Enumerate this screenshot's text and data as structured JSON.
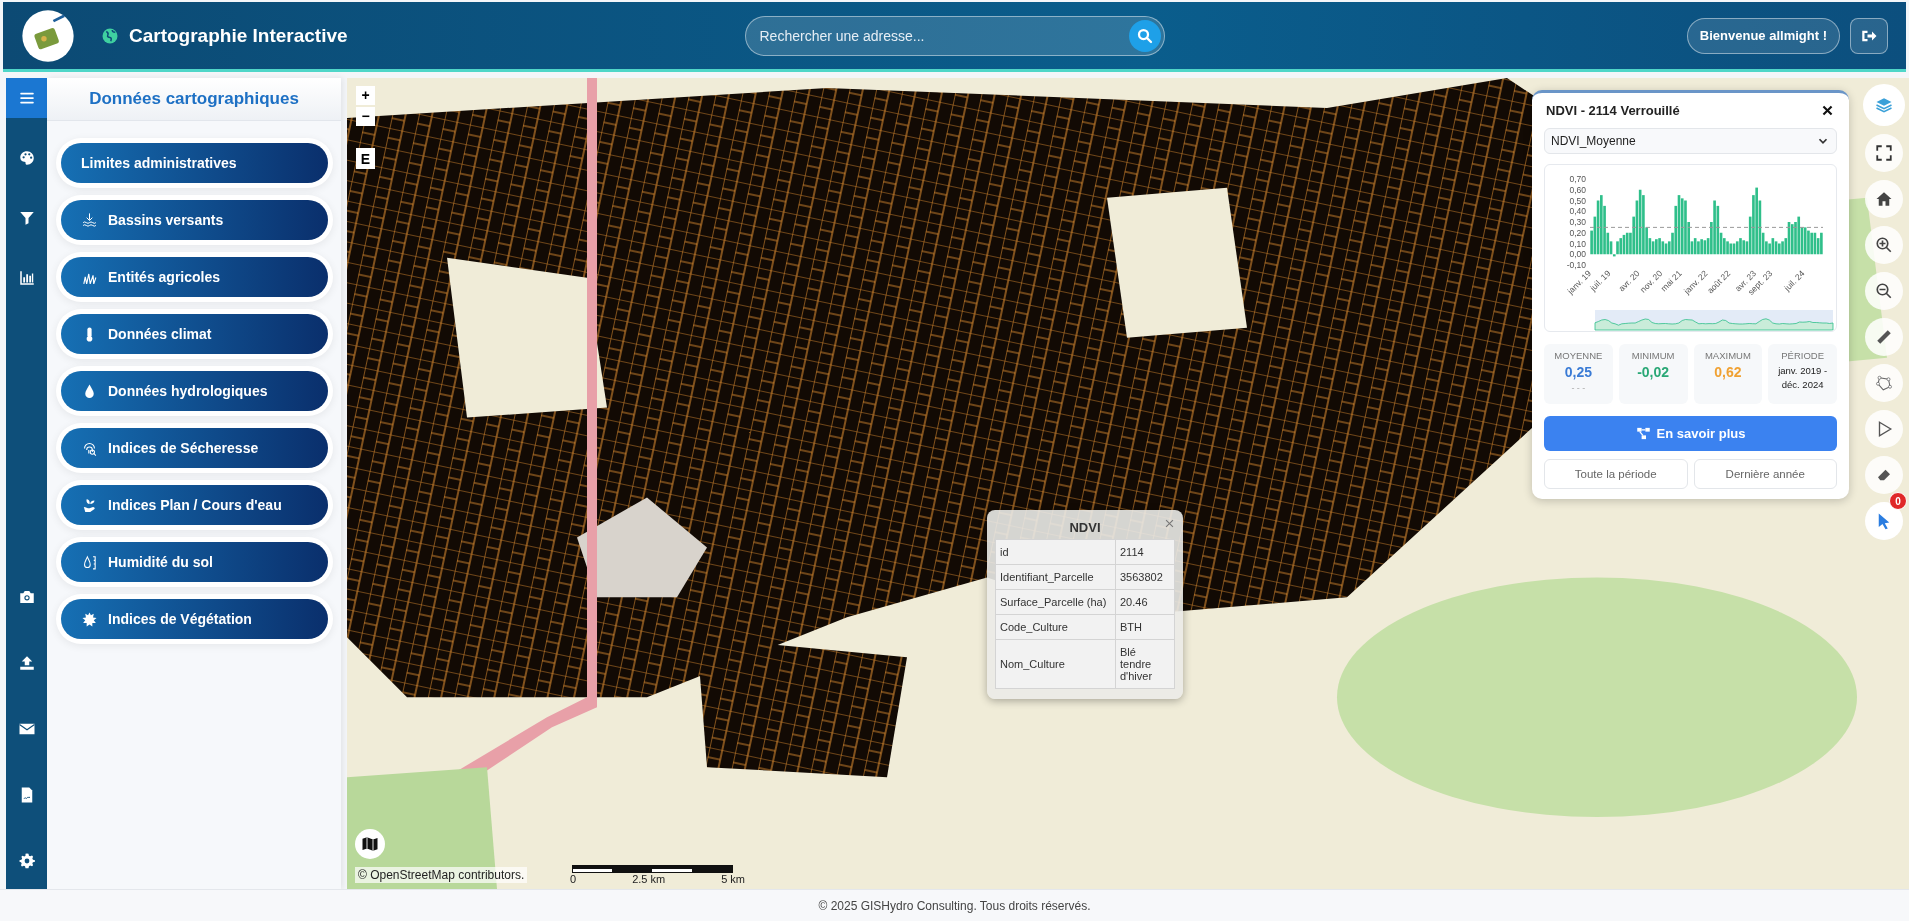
{
  "header": {
    "title": "Cartographie Interactive",
    "search": {
      "placeholder": "Rechercher une adresse..."
    },
    "welcome": "Bienvenue **allmight !**"
  },
  "sidebar": {
    "title": "Données cartographiques",
    "layers": [
      {
        "label": "Limites administratives"
      },
      {
        "label": "Bassins versants"
      },
      {
        "label": "Entités agricoles"
      },
      {
        "label": "Données climat"
      },
      {
        "label": "Données hydrologiques"
      },
      {
        "label": "Indices de Sécheresse"
      },
      {
        "label": "Indices Plan / Cours d'eau"
      },
      {
        "label": "Humidité du sol"
      },
      {
        "label": "Indices de Végétation"
      }
    ]
  },
  "map": {
    "zoom": [
      "+",
      "−"
    ],
    "compass": "E",
    "attribution": "© OpenStreetMap contributors.",
    "scale": [
      "0",
      "2.5 km",
      "5 km"
    ],
    "selection_count": "0",
    "popup": {
      "title": "NDVI",
      "rows": [
        {
          "key": "id",
          "value": "2114"
        },
        {
          "key": "Identifiant_Parcelle",
          "value": "3563802"
        },
        {
          "key": "Surface_Parcelle (ha)",
          "value": "20.46"
        },
        {
          "key": "Code_Culture",
          "value": "BTH"
        },
        {
          "key": "Nom_Culture",
          "value": "Blé tendre d'hiver"
        }
      ]
    },
    "ndvi_panel": {
      "title": "NDVI - 2114 Verrouillé",
      "chart_data": {
        "type": "bar",
        "ylim": [
          -0.1,
          0.7
        ],
        "categories": [
          "janv. 19",
          null,
          null,
          null,
          null,
          null,
          "juil. 19",
          null,
          null,
          null,
          null,
          null,
          null,
          null,
          null,
          "avr. 20",
          null,
          null,
          null,
          null,
          null,
          null,
          "nov. 20",
          null,
          null,
          null,
          null,
          null,
          "mai 21",
          null,
          null,
          null,
          null,
          null,
          null,
          null,
          "janv. 22",
          null,
          null,
          null,
          null,
          null,
          null,
          "août 22",
          null,
          null,
          null,
          null,
          null,
          null,
          null,
          "avr. 23",
          null,
          null,
          null,
          null,
          "sept. 23",
          null,
          null,
          null,
          null,
          null,
          null,
          null,
          null,
          null,
          "juil. 24",
          null,
          null,
          null,
          null,
          null
        ],
        "yticks": [
          {
            "value": 0.7,
            "label": "0,70"
          },
          {
            "value": 0.6,
            "label": "0,60"
          },
          {
            "value": 0.5,
            "label": "0,50"
          },
          {
            "value": 0.4,
            "label": "0,40"
          },
          {
            "value": 0.3,
            "label": "0,30"
          },
          {
            "value": 0.2,
            "label": "0,20"
          },
          {
            "value": 0.1,
            "label": "0,10"
          },
          {
            "value": 0,
            "label": "0,00"
          },
          {
            "value": -0.1,
            "label": "-0,10"
          }
        ],
        "series": [
          {
            "name": "NDVI_Moyenne",
            "color": "#2fbf8a",
            "values": [
              0.22,
              0.35,
              0.5,
              0.55,
              0.45,
              0.2,
              0.12,
              -0.02,
              0.12,
              0.15,
              0.18,
              0.2,
              0.2,
              0.35,
              0.5,
              0.6,
              0.55,
              0.25,
              0.15,
              0.12,
              0.14,
              0.15,
              0.12,
              0.1,
              0.12,
              0.2,
              0.45,
              0.55,
              0.52,
              0.5,
              0.3,
              0.12,
              0.15,
              0.12,
              0.14,
              0.13,
              0.15,
              0.3,
              0.5,
              0.45,
              0.2,
              0.15,
              0.12,
              0.1,
              0.1,
              0.12,
              0.15,
              0.13,
              0.12,
              0.35,
              0.55,
              0.62,
              0.5,
              0.2,
              0.12,
              0.1,
              0.15,
              0.12,
              0.1,
              0.12,
              0.15,
              0.3,
              0.28,
              0.3,
              0.35,
              0.25,
              0.25,
              0.22,
              0.2,
              0.2,
              0.15,
              0.2
            ]
          }
        ],
        "ref_lines": [
          {
            "axis": "y",
            "value": 0.25
          }
        ]
      },
      "stats": [
        {
          "label": "MOYENNE",
          "value": "0,25",
          "note": "- - -",
          "color": "#3a7bd5"
        },
        {
          "label": "MINIMUM",
          "value": "-0,02",
          "color": "#2aa876"
        },
        {
          "label": "MAXIMUM",
          "value": "0,62",
          "color": "#f0a132"
        },
        {
          "label": "PÉRIODE",
          "value": "janv. 2019 - déc. 2024"
        }
      ],
      "primary_button": "En savoir plus",
      "buttons": [
        "Toute la période",
        "Dernière année"
      ]
    }
  },
  "footer": "© 2025 GISHydro Consulting. Tous droits réservés."
}
